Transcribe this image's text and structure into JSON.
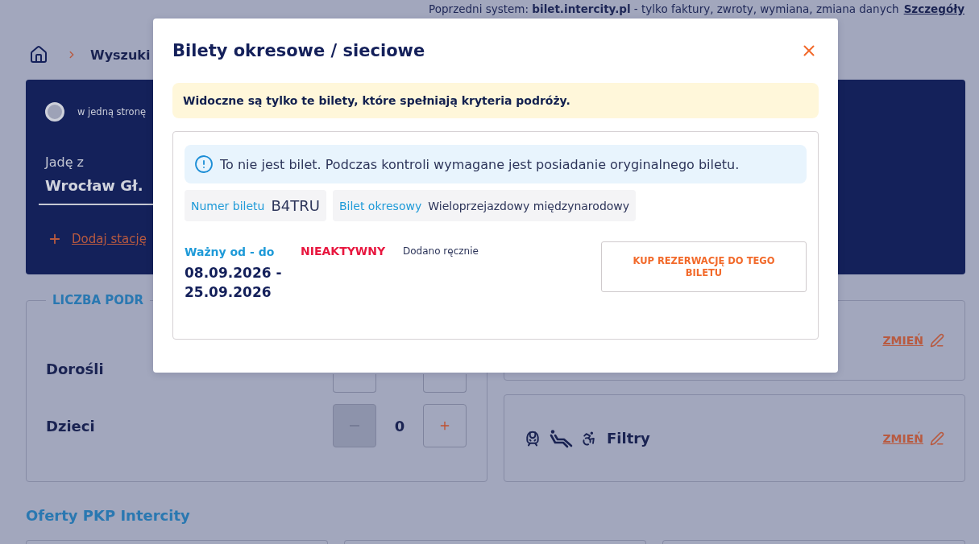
{
  "top_notice": {
    "text": "Poprzedni system: **bilet.intercity.pl** - tylko faktury, zwroty, wymiana, zmiana danych",
    "link": "Szczegóły"
  },
  "breadcrumb": {
    "current": "Wyszuki"
  },
  "search": {
    "trip_options": [
      {
        "label": "w jedną stronę",
        "selected": true
      }
    ],
    "from": {
      "label": "Jadę z",
      "value": "Wrocław Gł."
    },
    "add_station": "Dodaj stację"
  },
  "passengers": {
    "title": "LICZBA PODR",
    "rows": [
      {
        "kind": "covered",
        "label": "Dorośli"
      },
      {
        "kind": "stepper",
        "label": "Dzieci",
        "count": "0",
        "minus_disabled": true
      }
    ]
  },
  "options": [
    {
      "kind": "plain",
      "link": "ZMIEŃ"
    },
    {
      "kind": "filters",
      "title": "Filtry",
      "link": "ZMIEŃ"
    }
  ],
  "offers": {
    "title": "Oferty PKP Intercity"
  },
  "dialog": {
    "title": "Bilety okresowe / sieciowe",
    "notice": "Widoczne są tylko te bilety, które spełniają kryteria podróży.",
    "ticket": {
      "warning": "To nie jest bilet. Podczas kontroli wymagane jest posiadanie oryginalnego biletu.",
      "fields": [
        {
          "kind": "code",
          "label": "Numer biletu",
          "value": "B4TRU"
        },
        {
          "kind": "text",
          "label": "Bilet okresowy",
          "value": "Wieloprzejazdowy międzynarodowy"
        }
      ],
      "validity_label": "Ważny od - do",
      "validity": "08.09.2026 - 25.09.2026",
      "status": {
        "text": "NIEAKTYWNY",
        "active": false
      },
      "source": "Dodano ręcznie",
      "action": "KUP REZERWACJĘ DO TEGO BILETU"
    }
  }
}
